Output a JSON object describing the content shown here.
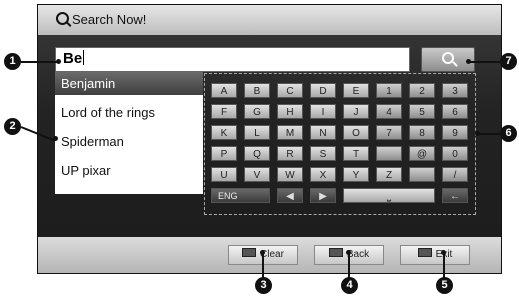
{
  "header": {
    "title": "Search Now!"
  },
  "search": {
    "value": "Be"
  },
  "results": [
    {
      "label": "Benjamin"
    },
    {
      "label": "Lord of the rings"
    },
    {
      "label": "Spiderman"
    },
    {
      "label": "UP pixar"
    }
  ],
  "keyboard": {
    "rows": [
      [
        "A",
        "B",
        "C",
        "D",
        "E",
        "1",
        "2",
        "3"
      ],
      [
        "F",
        "G",
        "H",
        "I",
        "J",
        "4",
        "5",
        "6"
      ],
      [
        "K",
        "L",
        "M",
        "N",
        "O",
        "7",
        "8",
        "9"
      ],
      [
        "P",
        "Q",
        "R",
        "S",
        "T",
        "",
        "@",
        "0"
      ],
      [
        "U",
        "V",
        "W",
        "X",
        "Y",
        "Z",
        "",
        "/"
      ]
    ],
    "bottom": {
      "eng": "ENG",
      "left": "◀",
      "right": "▶",
      "space": "⎵",
      "back": "←"
    }
  },
  "buttons": {
    "clear": "Clear",
    "back": "Back",
    "exit": "Exit"
  },
  "callouts": {
    "c1": "1",
    "c2": "2",
    "c3": "3",
    "c4": "4",
    "c5": "5",
    "c6": "6",
    "c7": "7"
  }
}
